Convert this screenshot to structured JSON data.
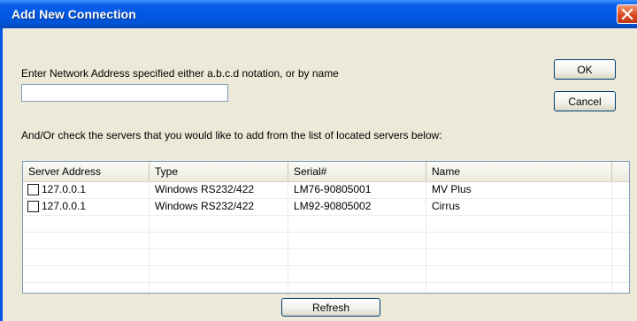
{
  "window": {
    "title": "Add New Connection"
  },
  "prompt": {
    "address_label": "Enter Network Address specified either a.b.c.d notation, or by name"
  },
  "address_field": {
    "value": "",
    "placeholder": ""
  },
  "buttons": {
    "ok": "OK",
    "cancel": "Cancel",
    "refresh": "Refresh"
  },
  "servers_label": "And/Or check the servers that you would like to add from the list of located servers below:",
  "server_list": {
    "columns": [
      "Server Address",
      "Type",
      "Serial#",
      "Name"
    ],
    "rows": [
      {
        "checked": false,
        "address": "127.0.0.1",
        "type": "Windows RS232/422",
        "serial": "LM76-90805001",
        "name": "MV Plus"
      },
      {
        "checked": false,
        "address": "127.0.0.1",
        "type": "Windows RS232/422",
        "serial": "LM92-90805002",
        "name": "Cirrus"
      }
    ]
  },
  "colors": {
    "titlebar": "#0054e3",
    "close_button": "#d9451f",
    "dialog_bg": "#ece9d8"
  },
  "icons": {
    "close": "close-icon"
  }
}
